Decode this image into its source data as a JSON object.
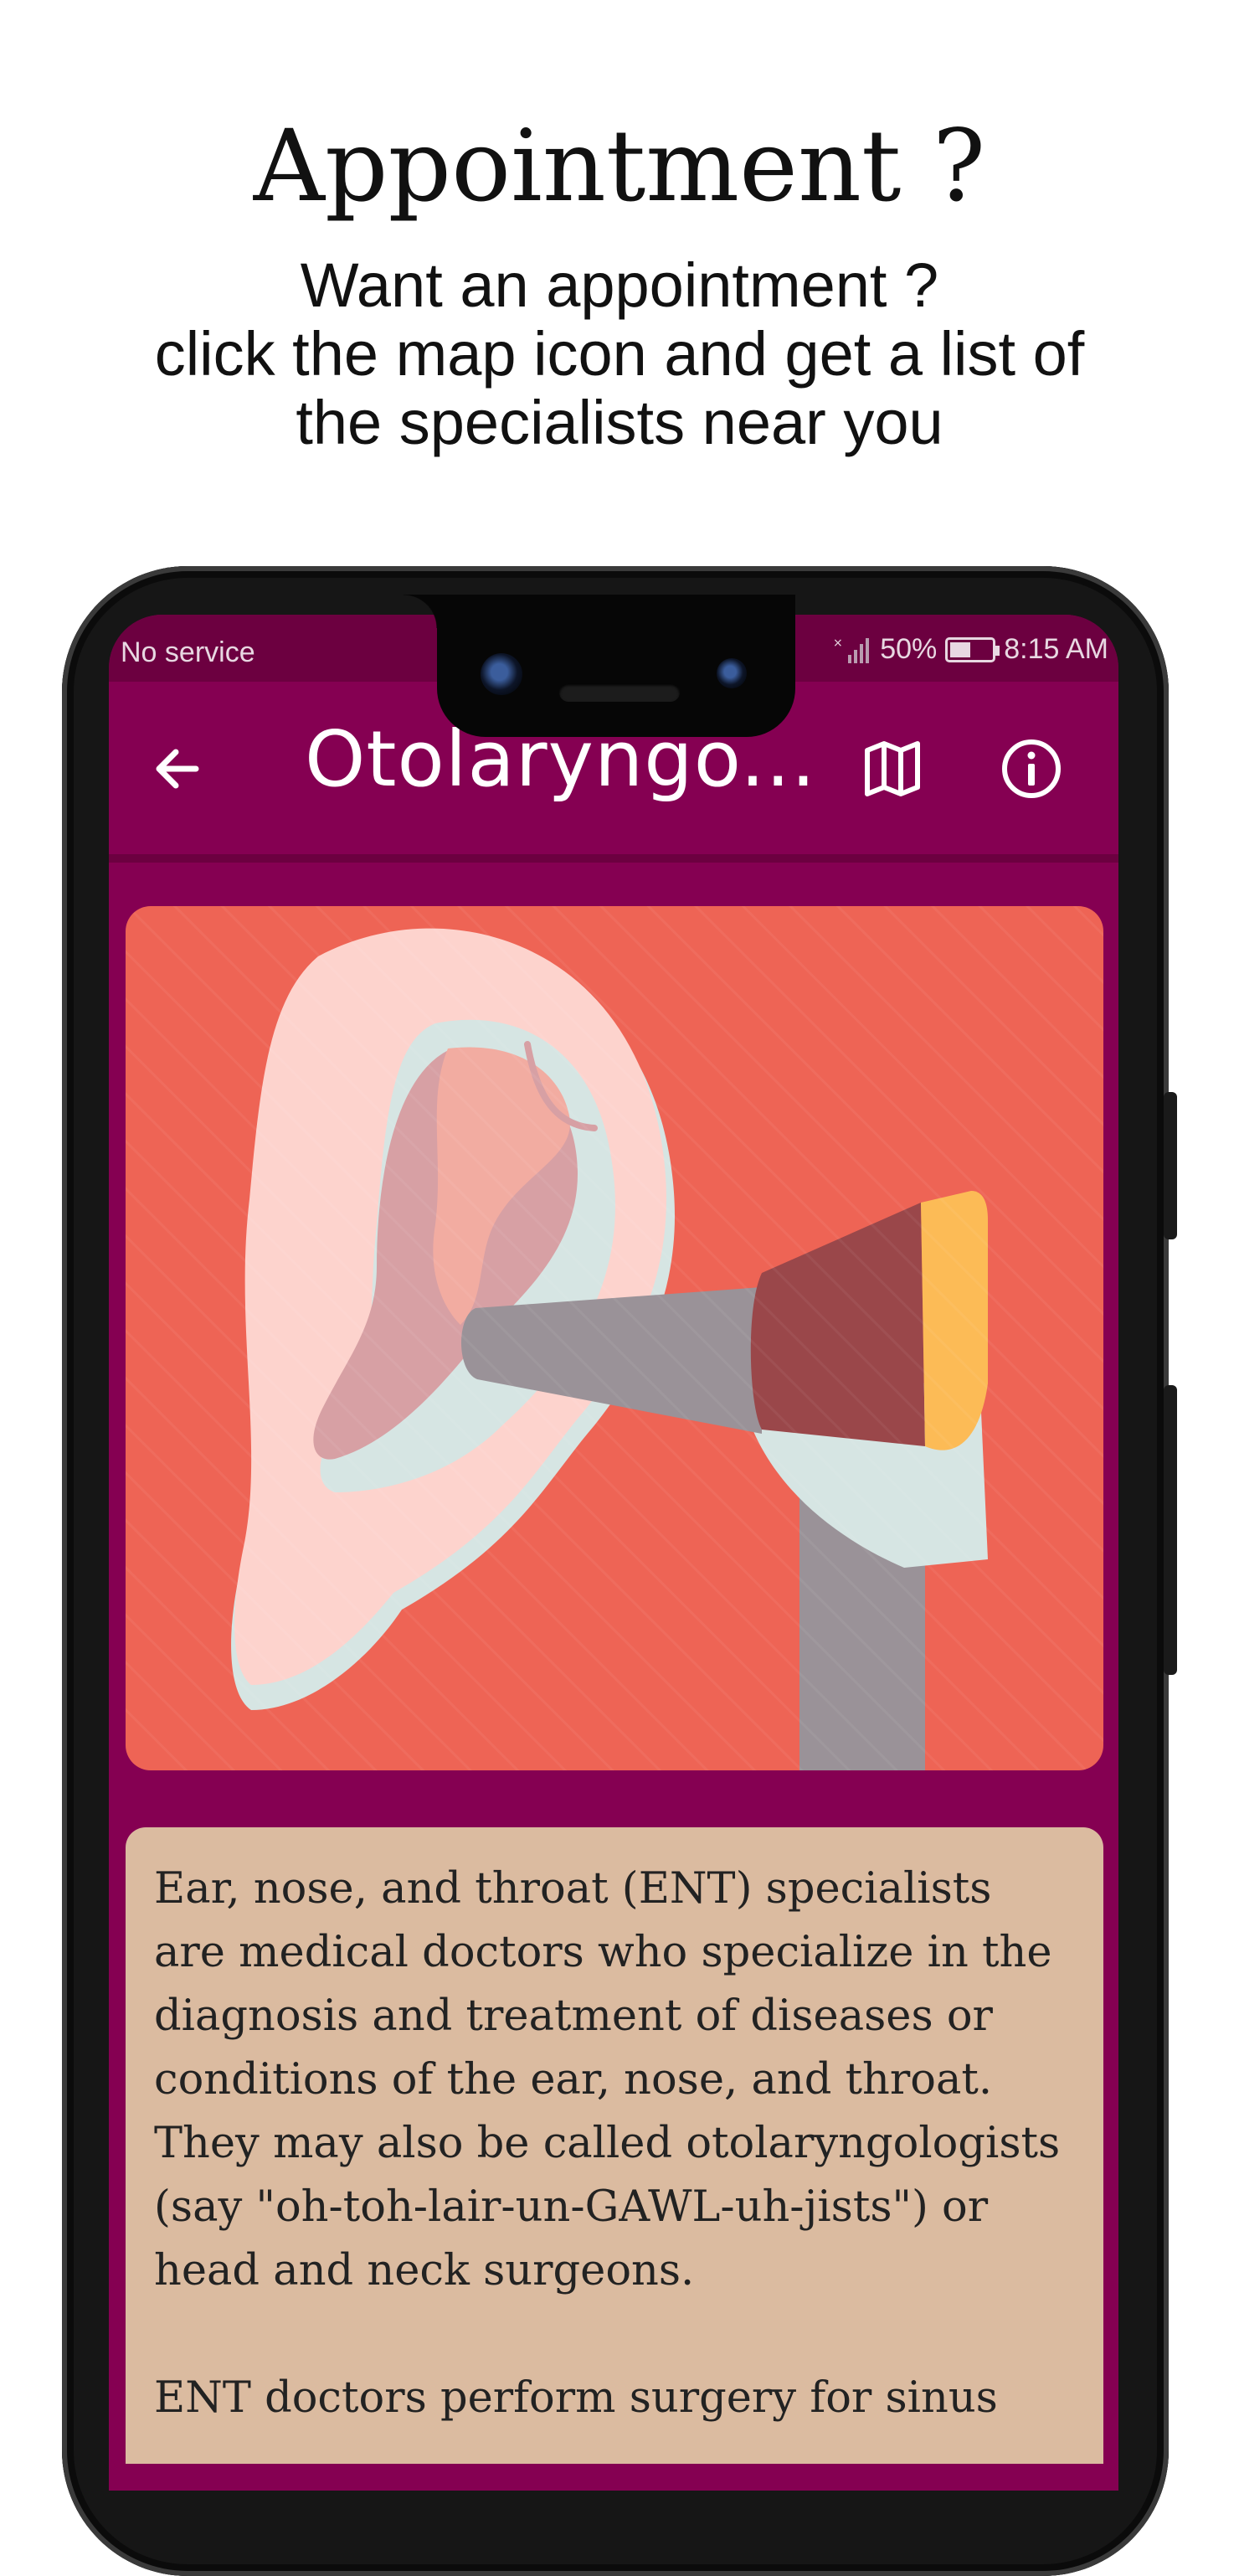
{
  "promo": {
    "title": "Appointment ?",
    "subtitle_lines": [
      "Want an appointment ?",
      "click the map icon and get a list of",
      "the specialists near you"
    ]
  },
  "status_bar": {
    "carrier": "No service",
    "battery_percent": "50%",
    "battery_level": 0.5,
    "time": "8:15 AM"
  },
  "app_bar": {
    "title": "Otolaryngo...",
    "back_icon": "arrow-left-icon",
    "map_icon": "map-icon",
    "info_icon": "info-icon"
  },
  "content": {
    "illustration": "ear-otoscope-illustration",
    "paragraphs": [
      "Ear, nose, and throat (ENT) specialists are medical doctors who specialize in the diagnosis and treatment of diseases or conditions of the ear, nose, and throat. They may also be called otolaryngologists (say \"oh-toh-lair-un-GAWL-uh-jists\") or head and neck surgeons.",
      "ENT doctors perform surgery for sinus"
    ]
  },
  "colors": {
    "app_primary": "#850052",
    "app_dark": "#6c0040",
    "image_bg": "#ee6455",
    "text_card_bg": "#dbbba0"
  }
}
